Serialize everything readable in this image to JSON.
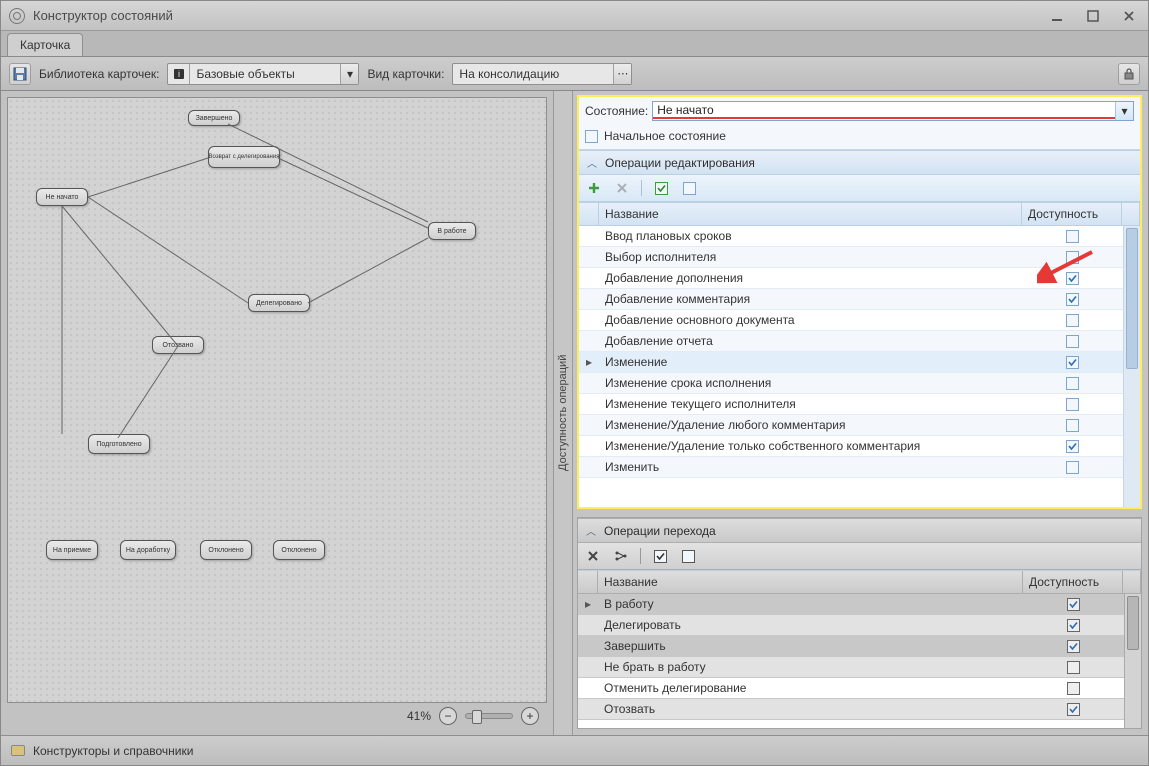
{
  "window": {
    "title": "Конструктор состояний"
  },
  "tabs": {
    "card": "Карточка"
  },
  "toolbar": {
    "library_label": "Библиотека карточек:",
    "library_value": "Базовые объекты",
    "card_type_label": "Вид карточки:",
    "card_type_value": "На консолидацию"
  },
  "canvas": {
    "nodes": {
      "not_started": "Не начато",
      "completed": "Завершено",
      "delegation_return": "Возврат с делегирования",
      "in_work": "В работе",
      "delegated": "Делегировано",
      "recalled": "Отозвано",
      "prepared": "Подготовлено",
      "on_approval": "На приемке",
      "for_revision": "На доработку",
      "rejected": "Отклонено",
      "declined": "Отклонено"
    },
    "zoom_percent": "41%"
  },
  "vertical_tab": "Доступность операций",
  "state_panel": {
    "state_label": "Состояние:",
    "state_value": "Не начато",
    "initial_label": "Начальное состояние",
    "edit_section_title": "Операции редактирования",
    "columns": {
      "name": "Название",
      "availability": "Доступность"
    },
    "rows": [
      {
        "name": "Ввод плановых сроков",
        "checked": false
      },
      {
        "name": "Выбор исполнителя",
        "checked": false
      },
      {
        "name": "Добавление дополнения",
        "checked": true
      },
      {
        "name": "Добавление комментария",
        "checked": true
      },
      {
        "name": "Добавление основного документа",
        "checked": false
      },
      {
        "name": "Добавление отчета",
        "checked": false
      },
      {
        "name": "Изменение",
        "checked": true,
        "selected": true,
        "underline": true
      },
      {
        "name": "Изменение срока исполнения",
        "checked": false
      },
      {
        "name": "Изменение текущего исполнителя",
        "checked": false
      },
      {
        "name": "Изменение/Удаление любого комментария",
        "checked": false
      },
      {
        "name": "Изменение/Удаление только собственного комментария",
        "checked": true
      },
      {
        "name": "Изменить",
        "checked": false
      }
    ]
  },
  "trans_panel": {
    "section_title": "Операции перехода",
    "columns": {
      "name": "Название",
      "availability": "Доступность"
    },
    "rows": [
      {
        "name": "В работу",
        "checked": true,
        "dark": true
      },
      {
        "name": "Делегировать",
        "checked": true
      },
      {
        "name": "Завершить",
        "checked": true,
        "dark": true
      },
      {
        "name": "Не брать в работу",
        "checked": false
      },
      {
        "name": "Отменить делегирование",
        "checked": false
      },
      {
        "name": "Отозвать",
        "checked": true
      }
    ]
  },
  "statusbar": {
    "label": "Конструкторы и справочники"
  }
}
